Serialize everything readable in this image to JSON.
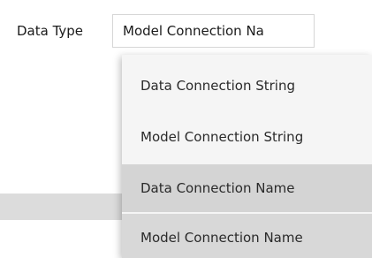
{
  "form": {
    "data_type_label": "Data Type",
    "data_type_value": "Model Connection Na"
  },
  "dropdown": {
    "options": [
      {
        "label": "Data Connection String",
        "highlighted": false
      },
      {
        "label": "Model Connection String",
        "highlighted": false
      },
      {
        "label": "Data Connection Name",
        "highlighted": true
      },
      {
        "label": "Model Connection Name",
        "highlighted": true
      }
    ]
  },
  "colors": {
    "dropdown_background": "#f5f5f5",
    "option_highlight": "#d4d4d4",
    "field_border": "#d6d6d6"
  }
}
